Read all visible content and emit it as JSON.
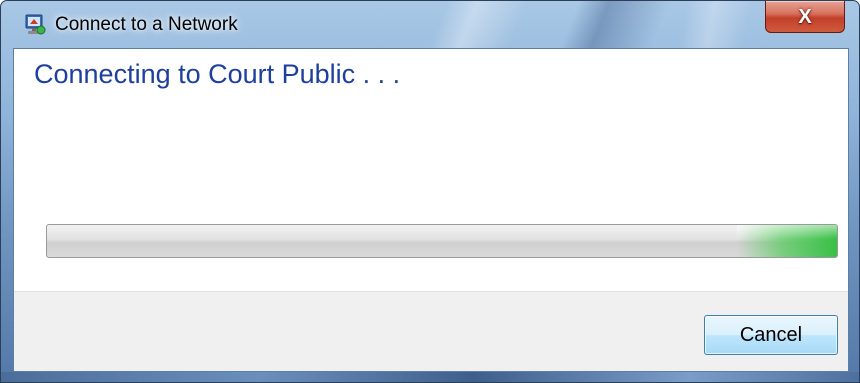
{
  "window": {
    "title": "Connect to a Network",
    "app_icon": "network-connect-icon",
    "close_glyph": "X",
    "close_icon": "close-icon"
  },
  "main": {
    "heading": "Connecting to Court Public . . ."
  },
  "progress": {
    "state": "indeterminate",
    "color": "#38c045"
  },
  "footer": {
    "cancel_label": "Cancel"
  },
  "colors": {
    "heading": "#1e3f9c",
    "close_button": "#c2402a",
    "cancel_button_border": "#3c7fb1"
  }
}
